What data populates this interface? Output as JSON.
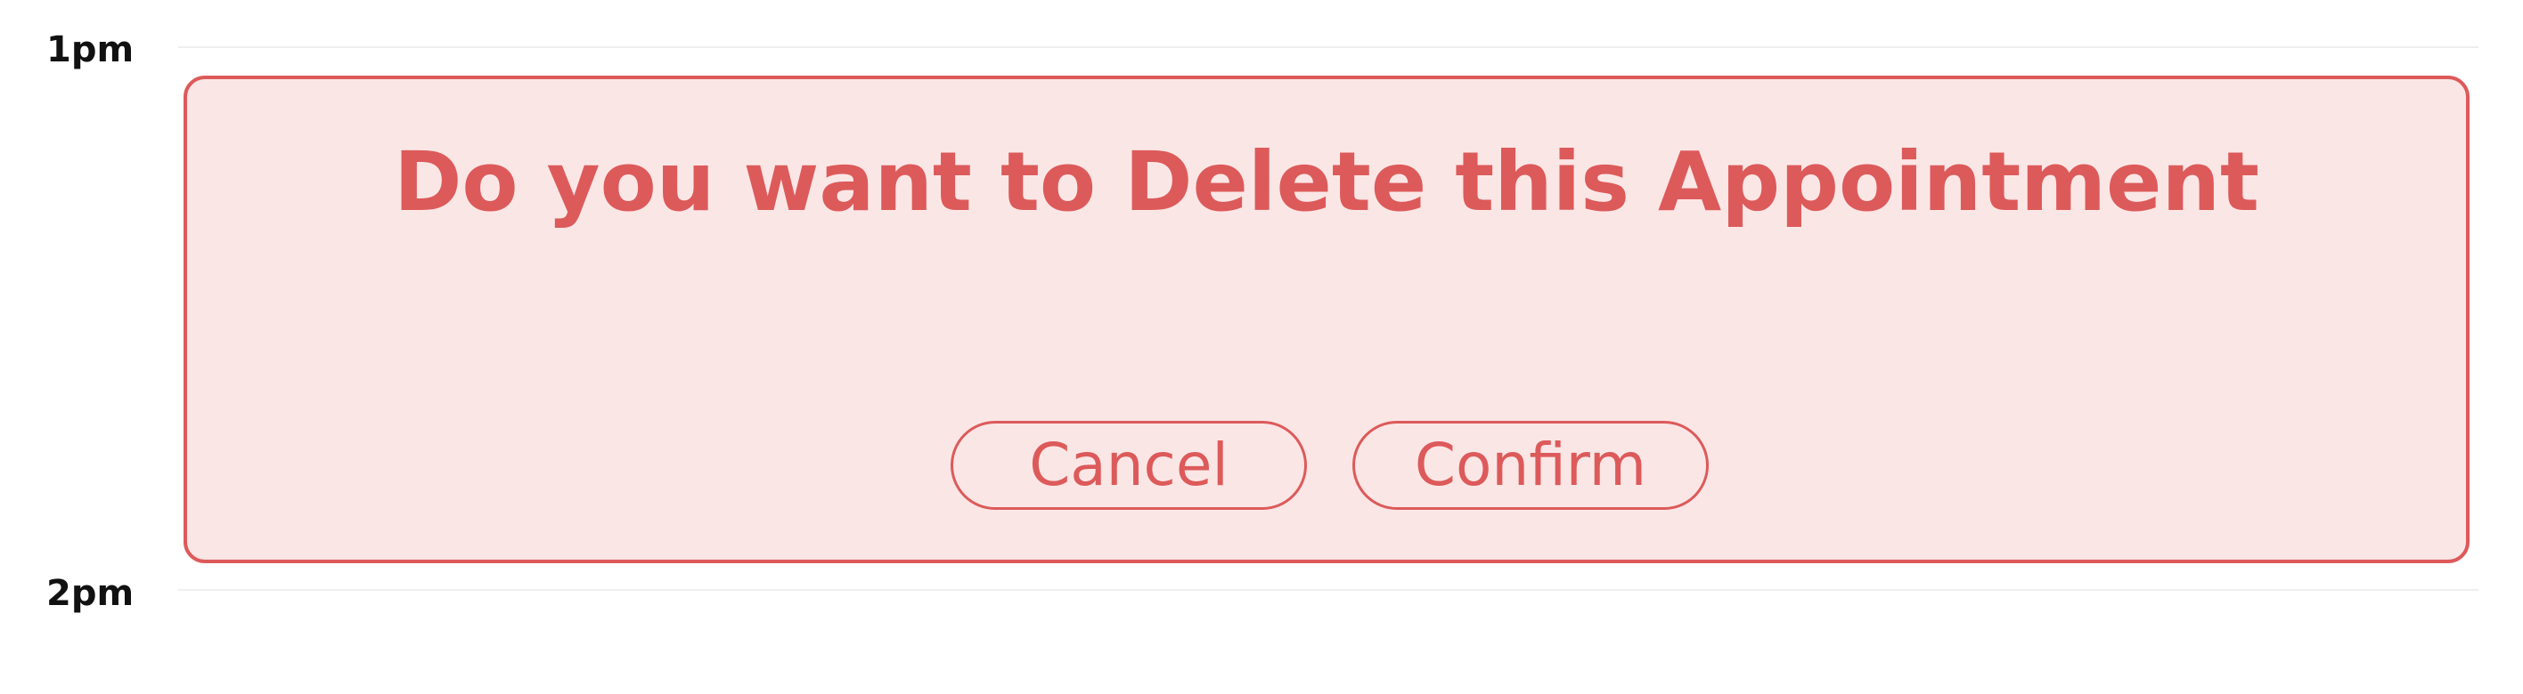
{
  "calendar": {
    "hours": [
      "1pm",
      "2pm"
    ]
  },
  "dialog": {
    "title": "Do you want to Delete this Appointment",
    "cancel_label": "Cancel",
    "confirm_label": "Confirm"
  },
  "colors": {
    "accent": "#dd5a5a",
    "dialog_background": "#fbe6e6",
    "hour_text": "#111111",
    "grid_line": "#efefef"
  }
}
